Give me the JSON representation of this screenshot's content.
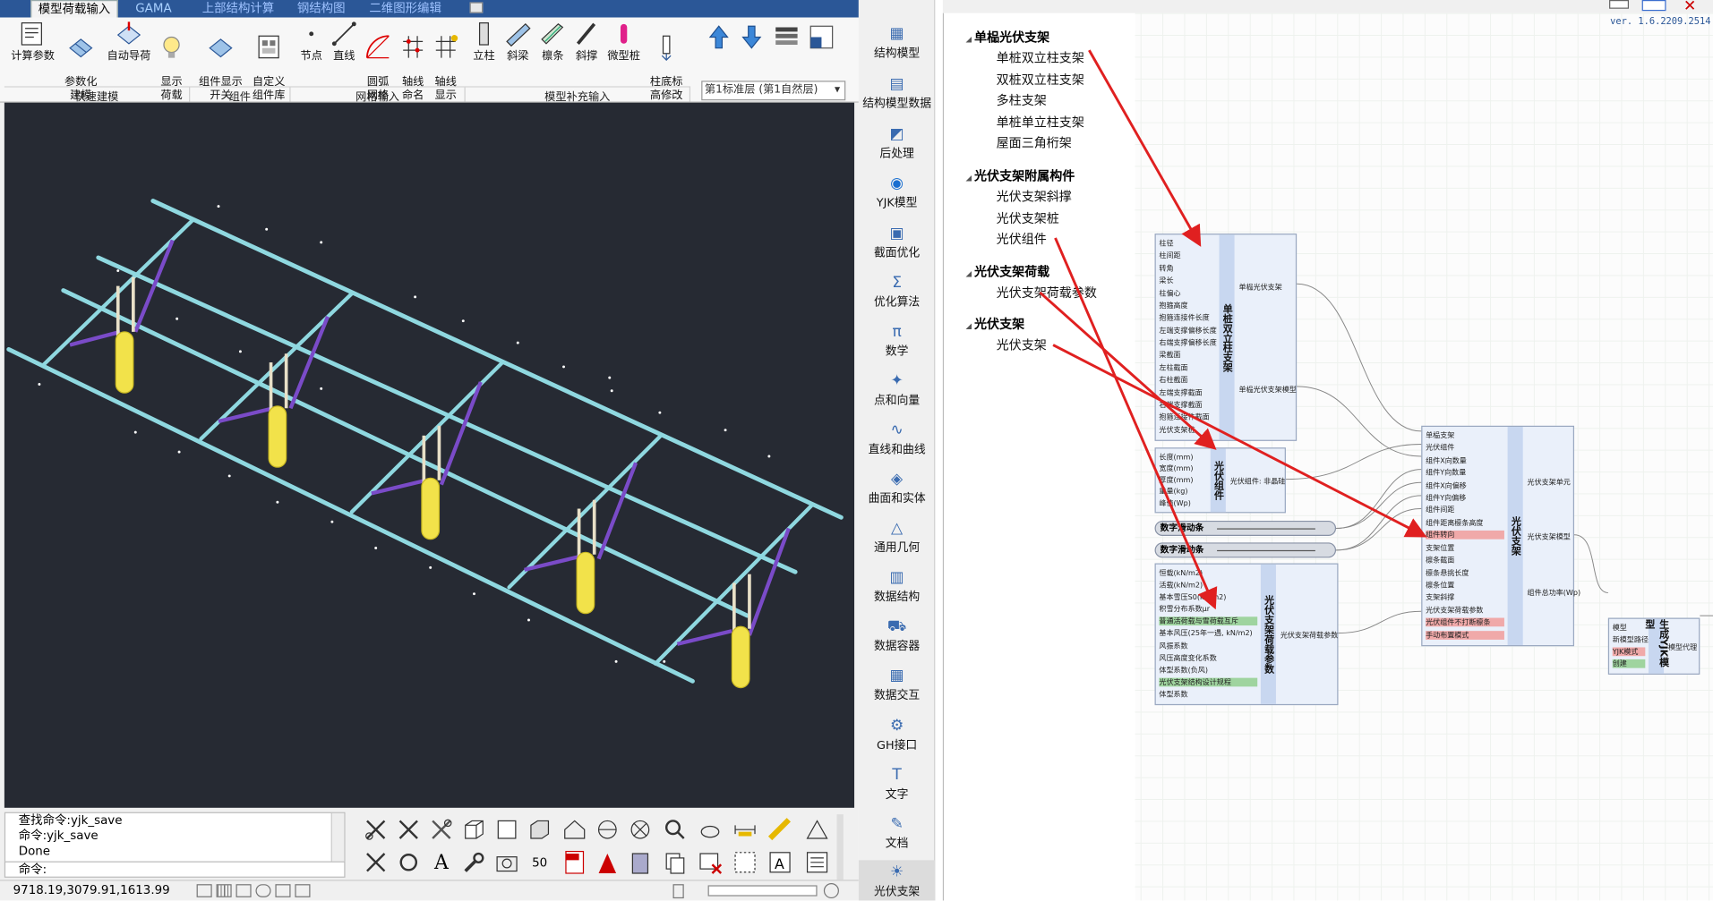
{
  "tabs": [
    {
      "label": "模型荷载输入",
      "active": true
    },
    {
      "label": "GAMA"
    },
    {
      "label": "上部结构计算"
    },
    {
      "label": "钢结构图"
    },
    {
      "label": "二维图形编辑"
    }
  ],
  "ribbon": {
    "buttons": [
      {
        "label": "计算参数",
        "icon": "calc-params-icon"
      },
      {
        "label": "参数化\n建模",
        "icon": "param-model-icon"
      },
      {
        "label": "自动导荷",
        "icon": "auto-load-icon"
      },
      {
        "label": "显示\n荷载",
        "icon": "show-load-icon"
      },
      {
        "label": "组件显示\n开关",
        "icon": "component-switch-icon"
      },
      {
        "label": "自定义\n组件库",
        "icon": "custom-library-icon"
      },
      {
        "label": "节点",
        "icon": "node-icon"
      },
      {
        "label": "直线",
        "icon": "line-icon"
      },
      {
        "label": "圆弧\n网格",
        "icon": "arc-grid-icon"
      },
      {
        "label": "轴线\n命名",
        "icon": "axis-name-icon"
      },
      {
        "label": "轴线\n显示",
        "icon": "axis-show-icon"
      },
      {
        "label": "立柱",
        "icon": "column-icon"
      },
      {
        "label": "斜梁",
        "icon": "slant-beam-icon"
      },
      {
        "label": "檩条",
        "icon": "purlin-icon"
      },
      {
        "label": "斜撑",
        "icon": "brace-icon"
      },
      {
        "label": "微型桩",
        "icon": "micro-pile-icon"
      },
      {
        "label": "柱底标\n高修改",
        "icon": "base-elev-icon"
      }
    ],
    "groups": [
      "快速建模",
      "组件",
      "网格输入",
      "模型补充输入"
    ],
    "floor_select": "第1标准层 (第1自然层)"
  },
  "command": {
    "lines": [
      "查找命令:yjk_save",
      "命令:yjk_save",
      "Done"
    ],
    "prompt": "命令:"
  },
  "status": {
    "coords": "9718.19,3079.91,1613.99"
  },
  "nav": [
    {
      "label": "结构模型"
    },
    {
      "label": "结构模型数据"
    },
    {
      "label": "后处理"
    },
    {
      "label": "YJK模型"
    },
    {
      "label": "截面优化"
    },
    {
      "label": "优化算法"
    },
    {
      "label": "数学"
    },
    {
      "label": "点和向量"
    },
    {
      "label": "直线和曲线"
    },
    {
      "label": "曲面和实体"
    },
    {
      "label": "通用几何"
    },
    {
      "label": "数据结构"
    },
    {
      "label": "数据容器"
    },
    {
      "label": "数据交互"
    },
    {
      "label": "GH接口"
    },
    {
      "label": "文字"
    },
    {
      "label": "文档"
    },
    {
      "label": "光伏支架",
      "selected": true
    }
  ],
  "version": "ver. 1.6.2209.2514",
  "tree": [
    {
      "title": "单榀光伏支架",
      "items": [
        "单桩双立柱支架",
        "双桩双立柱支架",
        "多柱支架",
        "单桩单立柱支架",
        "屋面三角桁架"
      ]
    },
    {
      "title": "光伏支架附属构件",
      "items": [
        "光伏支架斜撑",
        "光伏支架桩",
        "光伏组件"
      ]
    },
    {
      "title": "光伏支架荷载",
      "items": [
        "光伏支架荷载参数"
      ]
    },
    {
      "title": "光伏支架",
      "items": [
        "光伏支架"
      ]
    }
  ],
  "nodes": {
    "single": {
      "title": "单桩双立柱支架",
      "inputs": [
        "柱径",
        "柱间距",
        "转角",
        "梁长",
        "柱偏心",
        "抱箍高度",
        "抱箍连接件长度",
        "左端支撑偏移长度",
        "右端支撑偏移长度",
        "梁截面",
        "左柱截面",
        "右柱截面",
        "左端支撑截面",
        "右端支撑截面",
        "抱箍连接件截面",
        "光伏支架桩"
      ],
      "outputs": [
        "单榀光伏支架",
        "单榀光伏支架模型"
      ]
    },
    "module": {
      "title": "光伏组件",
      "inputs": [
        "长度(mm)",
        "宽度(mm)",
        "厚度(mm)",
        "重量(kg)",
        "峰值(Wp)"
      ],
      "outputs": [
        "光伏组件: 非晶硅"
      ]
    },
    "slider1": "数字滑动条",
    "slider2": "数字滑动条",
    "load": {
      "title": "光伏支架荷载参数",
      "inputs": [
        "恒载(kN/m2)",
        "活载(kN/m2)",
        "基本雪压S0(kN/m2)",
        "积雪分布系数μr",
        "普通活荷载与雪荷载互斥",
        "基本风压(25年一遇, kN/m2)",
        "风振系数",
        "风压高度变化系数",
        "体型系数(负风)",
        "光伏支架结构设计规程",
        "体型系数"
      ],
      "outputs": [
        "光伏支架荷载参数"
      ]
    },
    "main": {
      "title": "光伏支架",
      "inputs": [
        "单榀支架",
        "光伏组件",
        "组件X向数量",
        "组件Y向数量",
        "组件X向偏移",
        "组件Y向偏移",
        "组件间距",
        "组件距离檩条高度",
        "组件转向",
        "支架位置",
        "檩条截面",
        "檩条悬挑长度",
        "檩条位置",
        "支架斜撑",
        "光伏支架荷载参数",
        "光伏组件不打断檩条",
        "手动布置模式"
      ],
      "outputs": [
        "光伏支架单元",
        "光伏支架模型",
        "组件总功率(Wp)"
      ]
    },
    "yjk": {
      "title": "生成YJK模型",
      "inputs": [
        "模型",
        "新模型路径",
        "YJK模式",
        "创建"
      ],
      "outputs": [
        "模型代理"
      ]
    }
  },
  "colors": {
    "accent": "#2b5797",
    "arrow": "#e02020",
    "beam": "#8fd8e0",
    "brace": "#7a4bc8",
    "pile": "#f2e24a"
  }
}
